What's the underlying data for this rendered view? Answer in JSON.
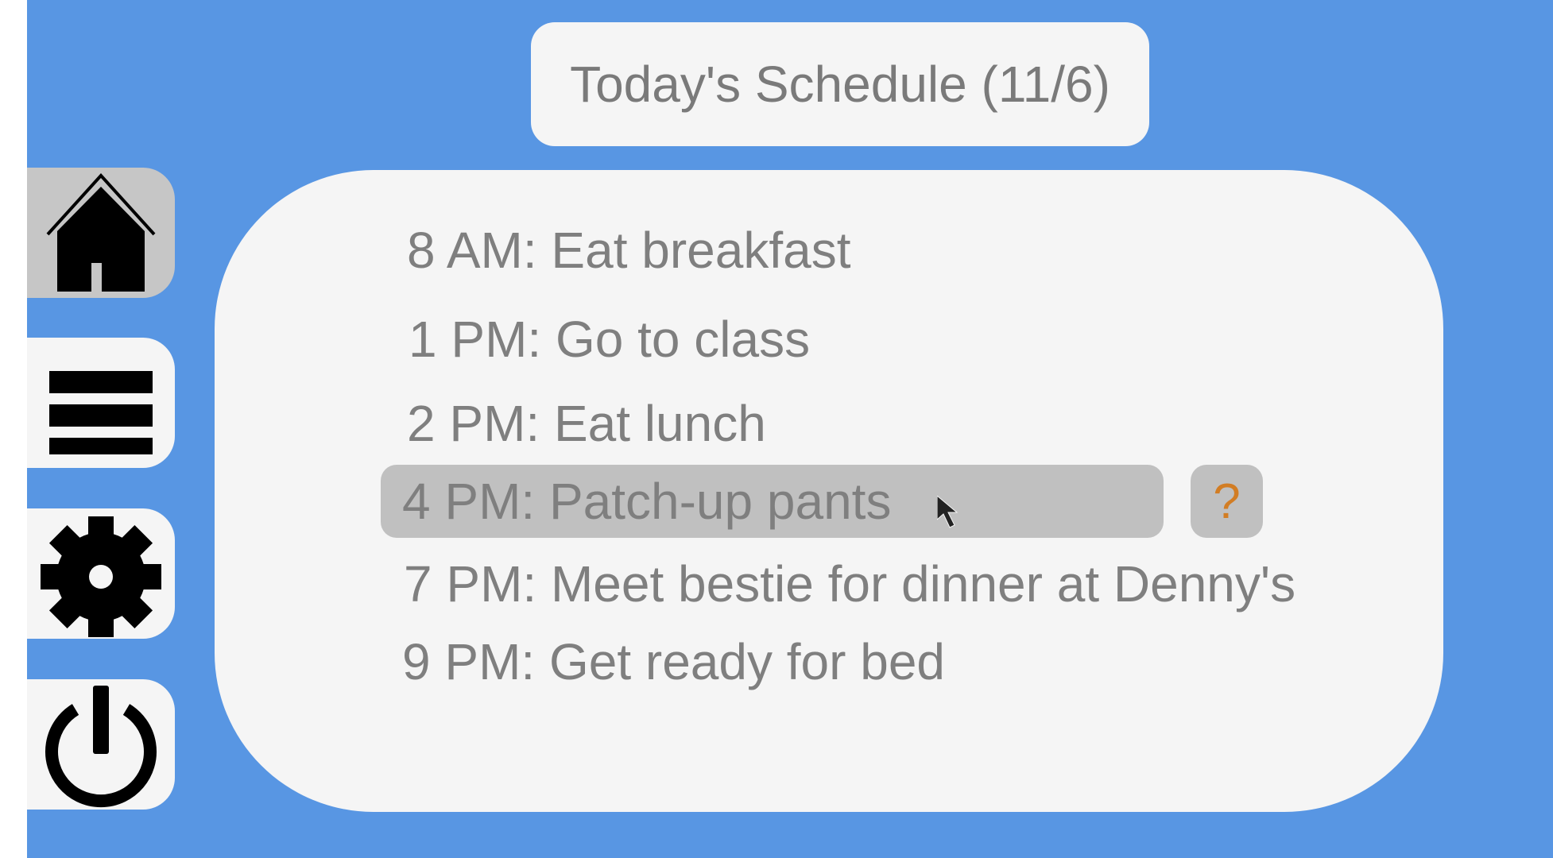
{
  "header": {
    "title": "Today's Schedule (11/6)"
  },
  "schedule": {
    "items": [
      {
        "label": "8 AM: Eat breakfast"
      },
      {
        "label": "1 PM: Go to class"
      },
      {
        "label": "2 PM: Eat lunch"
      },
      {
        "label": "4 PM: Patch-up pants",
        "selected": true
      },
      {
        "label": "7 PM: Meet bestie for dinner at Denny's"
      },
      {
        "label": "9 PM: Get ready for bed"
      }
    ],
    "help_label": "?"
  },
  "sidebar": {
    "items": [
      {
        "icon": "home-icon",
        "active": true
      },
      {
        "icon": "menu-icon",
        "active": false
      },
      {
        "icon": "settings-gear-icon",
        "active": false
      },
      {
        "icon": "power-icon",
        "active": false
      }
    ]
  },
  "colors": {
    "background": "#5896e3",
    "panel": "#f5f5f5",
    "text": "#7f7f7f",
    "highlight": "#c0c0c0",
    "help_accent": "#d27d24"
  }
}
